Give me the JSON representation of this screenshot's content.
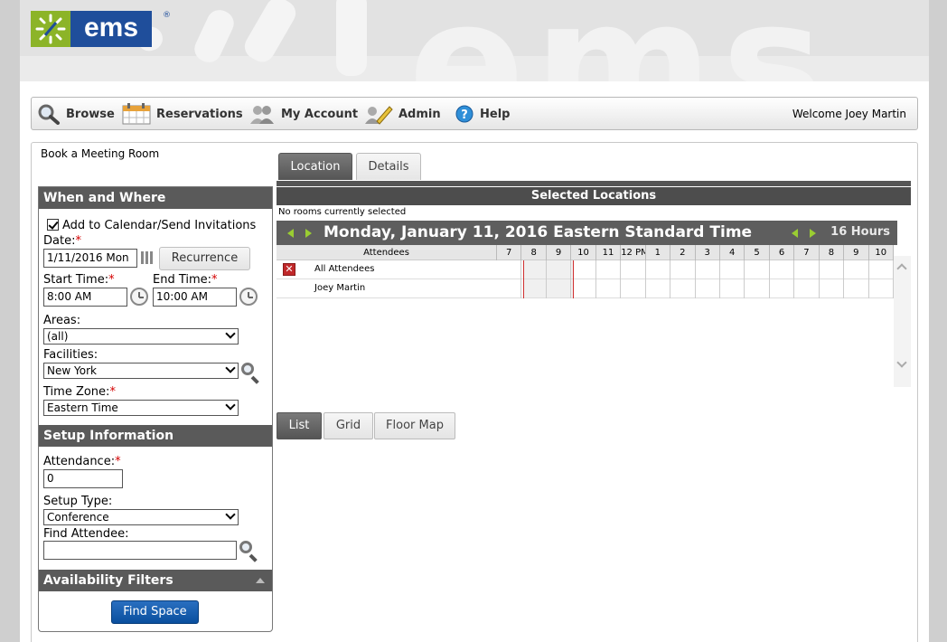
{
  "logo": {
    "text": "ems",
    "reg": "®"
  },
  "banner": {
    "watermark": "ems"
  },
  "nav": {
    "items": [
      {
        "label": "Browse",
        "icon": "magnifier-icon"
      },
      {
        "label": "Reservations",
        "icon": "calendar-icon"
      },
      {
        "label": "My Account",
        "icon": "users-icon"
      },
      {
        "label": "Admin",
        "icon": "pencil-icon"
      },
      {
        "label": "Help",
        "icon": "help-icon"
      }
    ],
    "welcome": "Welcome Joey Martin"
  },
  "breadcrumb": "Book a Meeting Room",
  "tabs": [
    {
      "label": "Location",
      "active": true
    },
    {
      "label": "Details",
      "active": false
    }
  ],
  "when_where": {
    "header": "When and Where",
    "add_to_calendar": "Add to Calendar/Send Invitations",
    "date_label": "Date:",
    "date_value": "1/11/2016 Mon",
    "recurrence": "Recurrence",
    "start_label": "Start Time:",
    "start_value": "8:00 AM",
    "end_label": "End Time:",
    "end_value": "10:00 AM",
    "areas_label": "Areas:",
    "areas_value": "(all)",
    "facilities_label": "Facilities:",
    "facilities_value": "New York",
    "timezone_label": "Time Zone:",
    "timezone_value": "Eastern Time",
    "required_mark": "*"
  },
  "setup": {
    "header": "Setup Information",
    "attendance_label": "Attendance:",
    "attendance_value": "0",
    "setup_type_label": "Setup Type:",
    "setup_type_value": "Conference",
    "find_attendee_label": "Find Attendee:",
    "find_attendee_value": ""
  },
  "filters": {
    "header": "Availability Filters"
  },
  "find_space": "Find Space",
  "locations": {
    "header": "Selected Locations",
    "no_rooms": "No rooms currently selected",
    "date_title": "Monday, January 11, 2016 Eastern Standard Time",
    "hours": "16 Hours",
    "attendees_header": "Attendees",
    "hour_labels": [
      "7",
      "8",
      "9",
      "10",
      "11",
      "12 PM",
      "1",
      "2",
      "3",
      "4",
      "5",
      "6",
      "7",
      "8",
      "9",
      "10"
    ],
    "rows": [
      {
        "name": "All Attendees",
        "removable": true
      },
      {
        "name": "Joey Martin",
        "removable": false
      }
    ]
  },
  "view_tabs": [
    {
      "label": "List",
      "active": true
    },
    {
      "label": "Grid",
      "active": false
    },
    {
      "label": "Floor Map",
      "active": false
    }
  ],
  "colors": {
    "brand_blue": "#1f4e9b",
    "brand_green": "#8cb428",
    "header_gray": "#5a5a5a",
    "button_blue": "#0a4f9e",
    "required_red": "#d40000"
  }
}
